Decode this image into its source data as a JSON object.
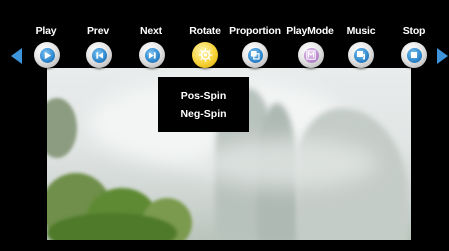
{
  "toolbar": {
    "buttons": [
      {
        "label": "Play",
        "icon": "play-icon"
      },
      {
        "label": "Prev",
        "icon": "previous-icon"
      },
      {
        "label": "Next",
        "icon": "next-icon"
      },
      {
        "label": "Rotate",
        "icon": "rotate-icon",
        "active": true
      },
      {
        "label": "Proportion",
        "icon": "proportion-icon"
      },
      {
        "label": "PlayMode",
        "icon": "playmode-icon"
      },
      {
        "label": "Music",
        "icon": "music-icon"
      },
      {
        "label": "Stop",
        "icon": "stop-icon"
      }
    ],
    "left_arrow_icon": "arrow-left-icon",
    "right_arrow_icon": "arrow-right-icon"
  },
  "rotate_menu": {
    "items": [
      "Pos-Spin",
      "Neg-Spin"
    ]
  },
  "colors": {
    "background": "#000000",
    "accent_blue": "#2d86cc",
    "active_yellow": "#f7d238",
    "label_text": "#ffffff"
  }
}
